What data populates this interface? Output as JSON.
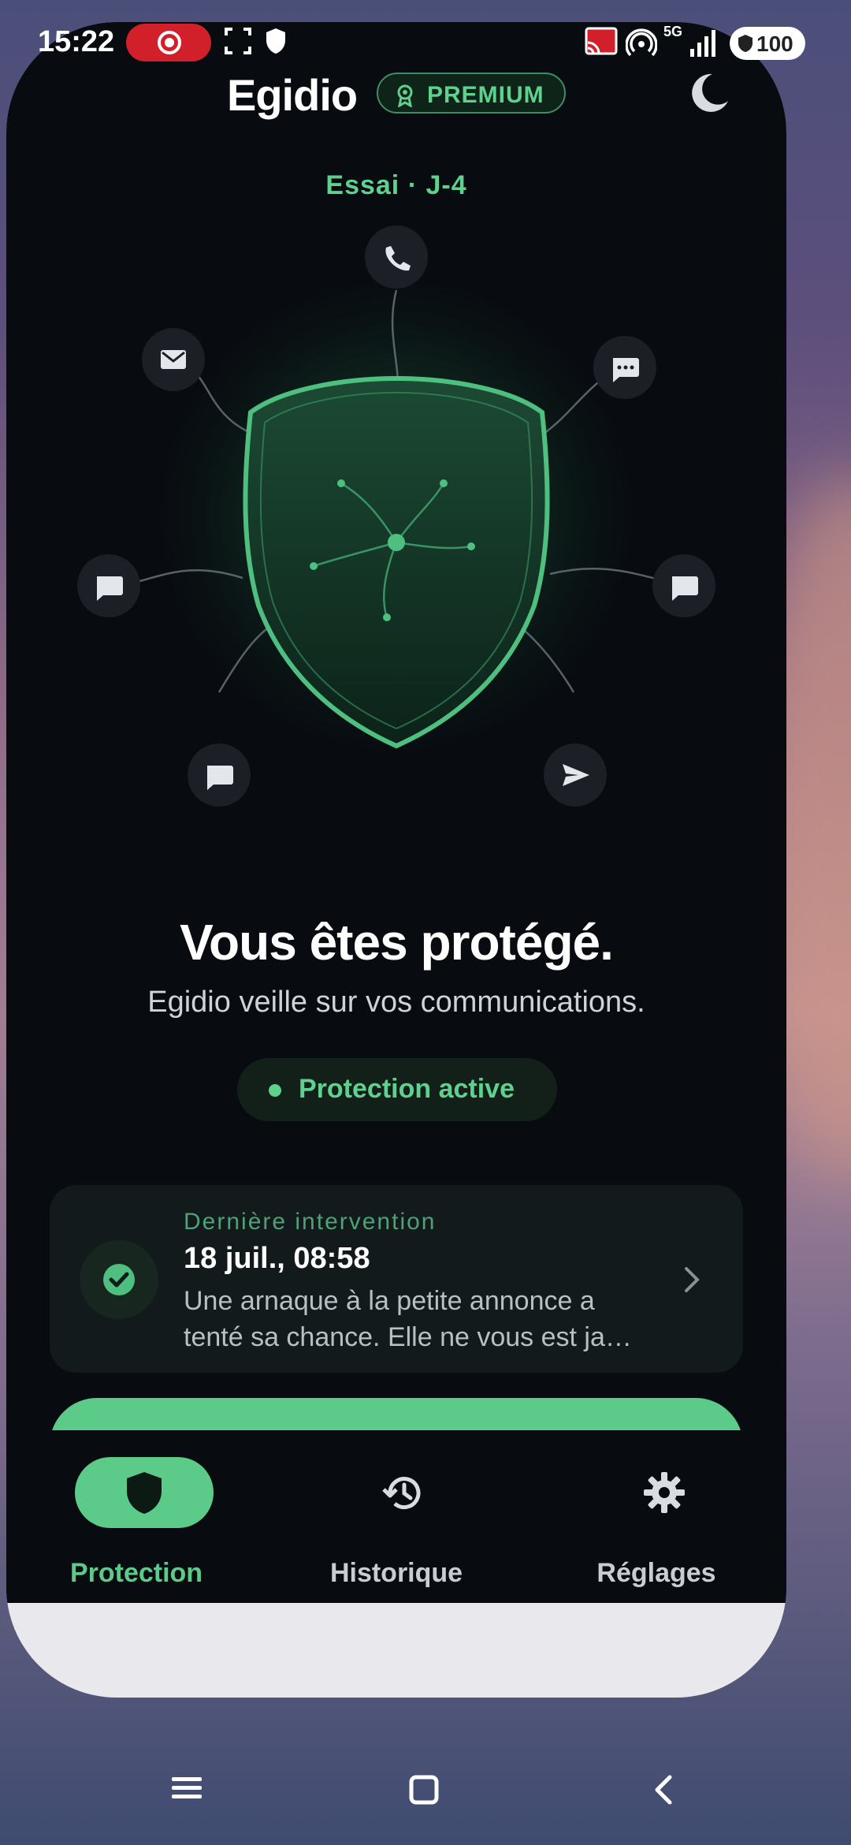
{
  "status_bar": {
    "time": "15:22",
    "battery": "100",
    "network": "5G"
  },
  "header": {
    "title": "Egidio",
    "badge": "PREMIUM",
    "badge_icon": "award-icon",
    "theme_icon": "moon-icon"
  },
  "trial": "Essai · J-4",
  "shield_nodes": [
    "phone-icon",
    "mail-icon",
    "chat-dots-icon",
    "chat-icon",
    "chat-icon",
    "chat-icon",
    "send-icon"
  ],
  "hero": {
    "headline": "Vous êtes protégé.",
    "subline": "Egidio veille sur vos communications.",
    "status": "Protection active"
  },
  "last_intervention": {
    "label": "Dernière intervention",
    "date": "18 juil., 08:58",
    "message": "Une arnaque à la petite annonce a tenté sa chance. Elle ne vous est ja…"
  },
  "nav": {
    "items": [
      {
        "label": "Protection",
        "icon": "shield-icon",
        "active": true
      },
      {
        "label": "Historique",
        "icon": "history-icon",
        "active": false
      },
      {
        "label": "Réglages",
        "icon": "gear-icon",
        "active": false
      }
    ]
  },
  "colors": {
    "accent": "#5ccb8a",
    "background": "#080b10",
    "card": "#121a1c"
  }
}
